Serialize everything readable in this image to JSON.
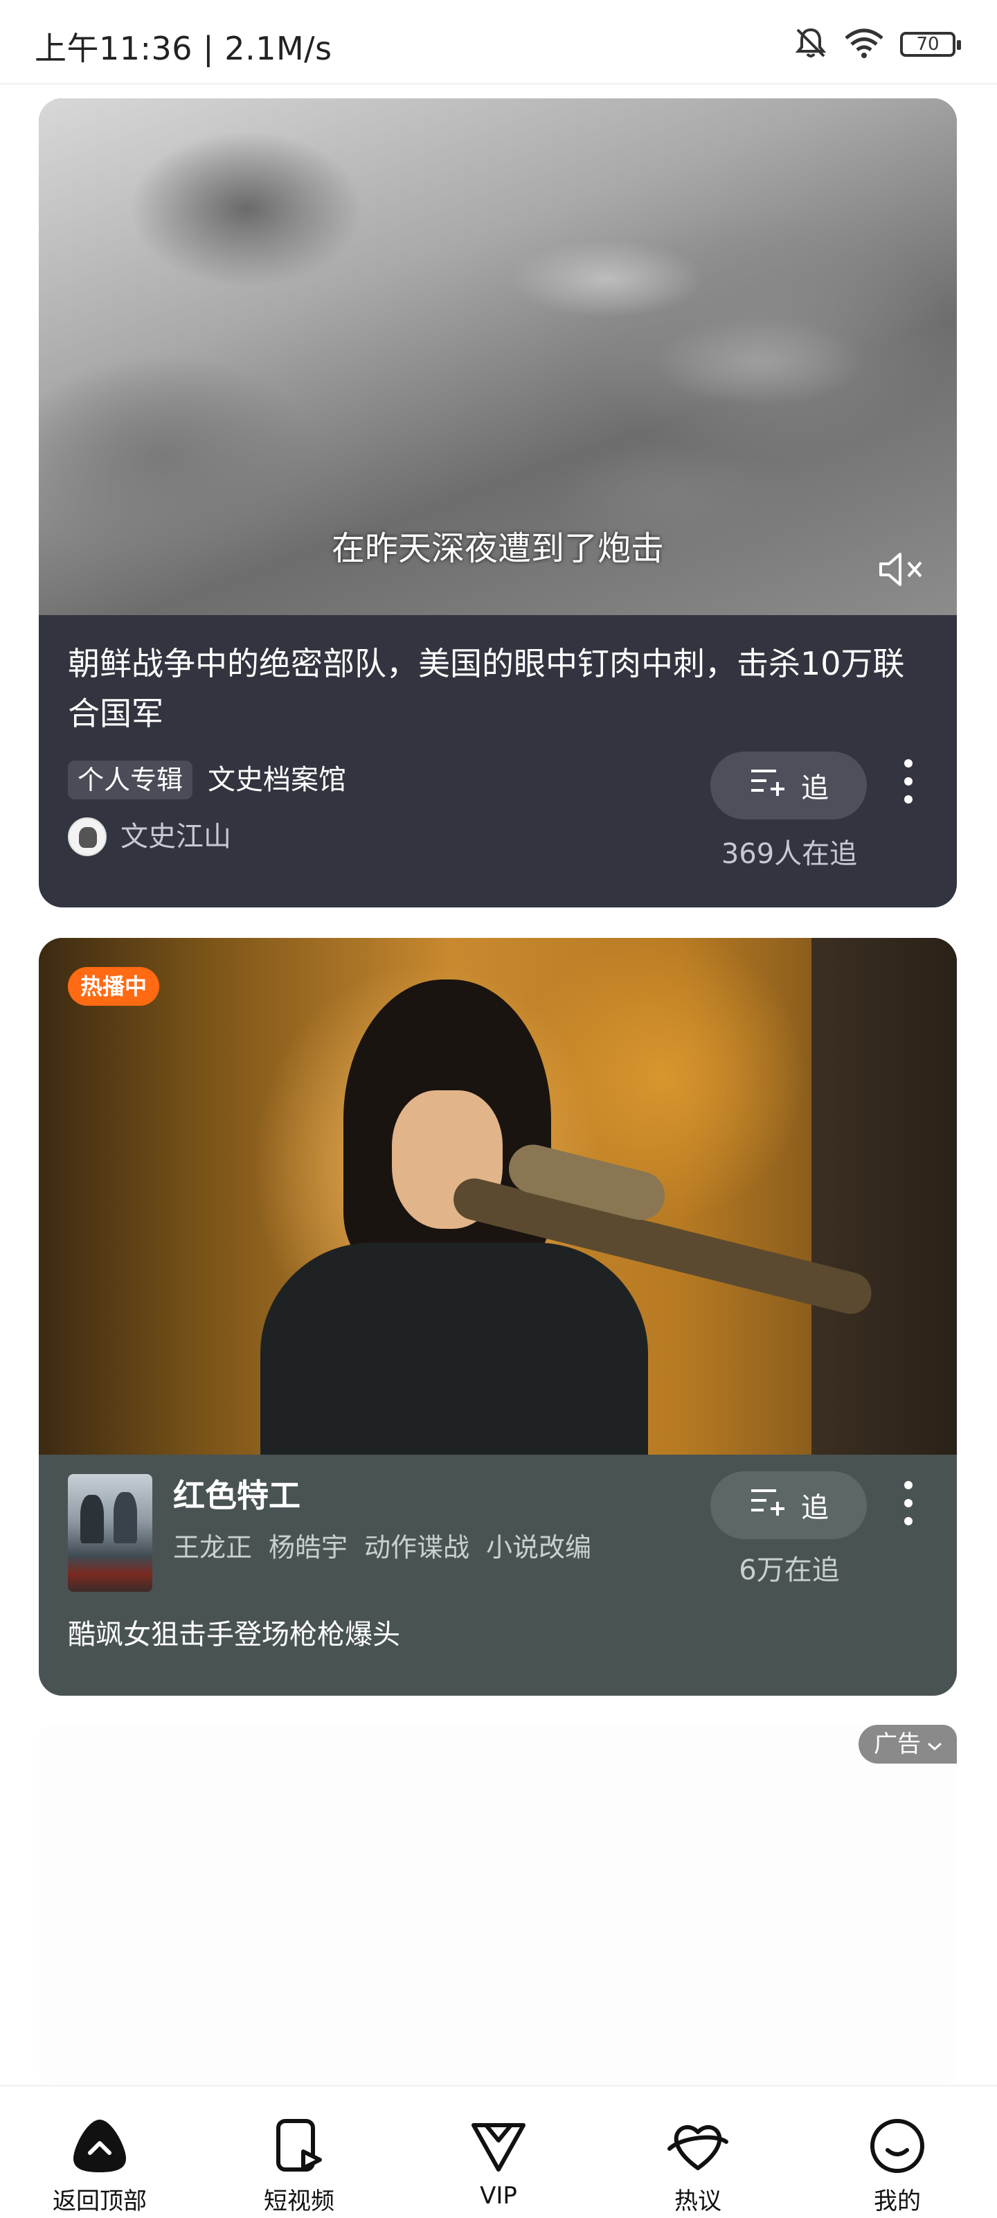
{
  "status_bar": {
    "time": "上午11:36 | 2.1M/s",
    "battery": "70",
    "icons": [
      "mute-bell-icon",
      "wifi-icon",
      "battery-icon"
    ]
  },
  "card1": {
    "subtitle": "在昨天深夜遭到了炮击",
    "title": "朝鲜战争中的绝密部队，美国的眼中钉肉中刺，击杀10万联合国军",
    "tag": "个人专辑",
    "album": "文史档案馆",
    "author": "文史江山",
    "follow_label": "追",
    "follow_count": "369人在追",
    "icons": [
      "mute-icon",
      "add-to-list-icon",
      "more-icon"
    ]
  },
  "card2": {
    "badge": "热播中",
    "title": "红色特工",
    "tags": [
      "王龙正",
      "杨皓宇",
      "动作谍战",
      "小说改编"
    ],
    "follow_label": "追",
    "follow_count": "6万在追",
    "description": "酷飒女狙击手登场枪枪爆头"
  },
  "ad": {
    "label": "广告"
  },
  "bottom_nav": {
    "items": [
      {
        "label": "返回顶部",
        "icon": "back-to-top-icon"
      },
      {
        "label": "短视频",
        "icon": "short-video-icon"
      },
      {
        "label": "VIP",
        "icon": "vip-icon"
      },
      {
        "label": "热议",
        "icon": "planet-icon"
      },
      {
        "label": "我的",
        "icon": "profile-icon"
      }
    ]
  }
}
